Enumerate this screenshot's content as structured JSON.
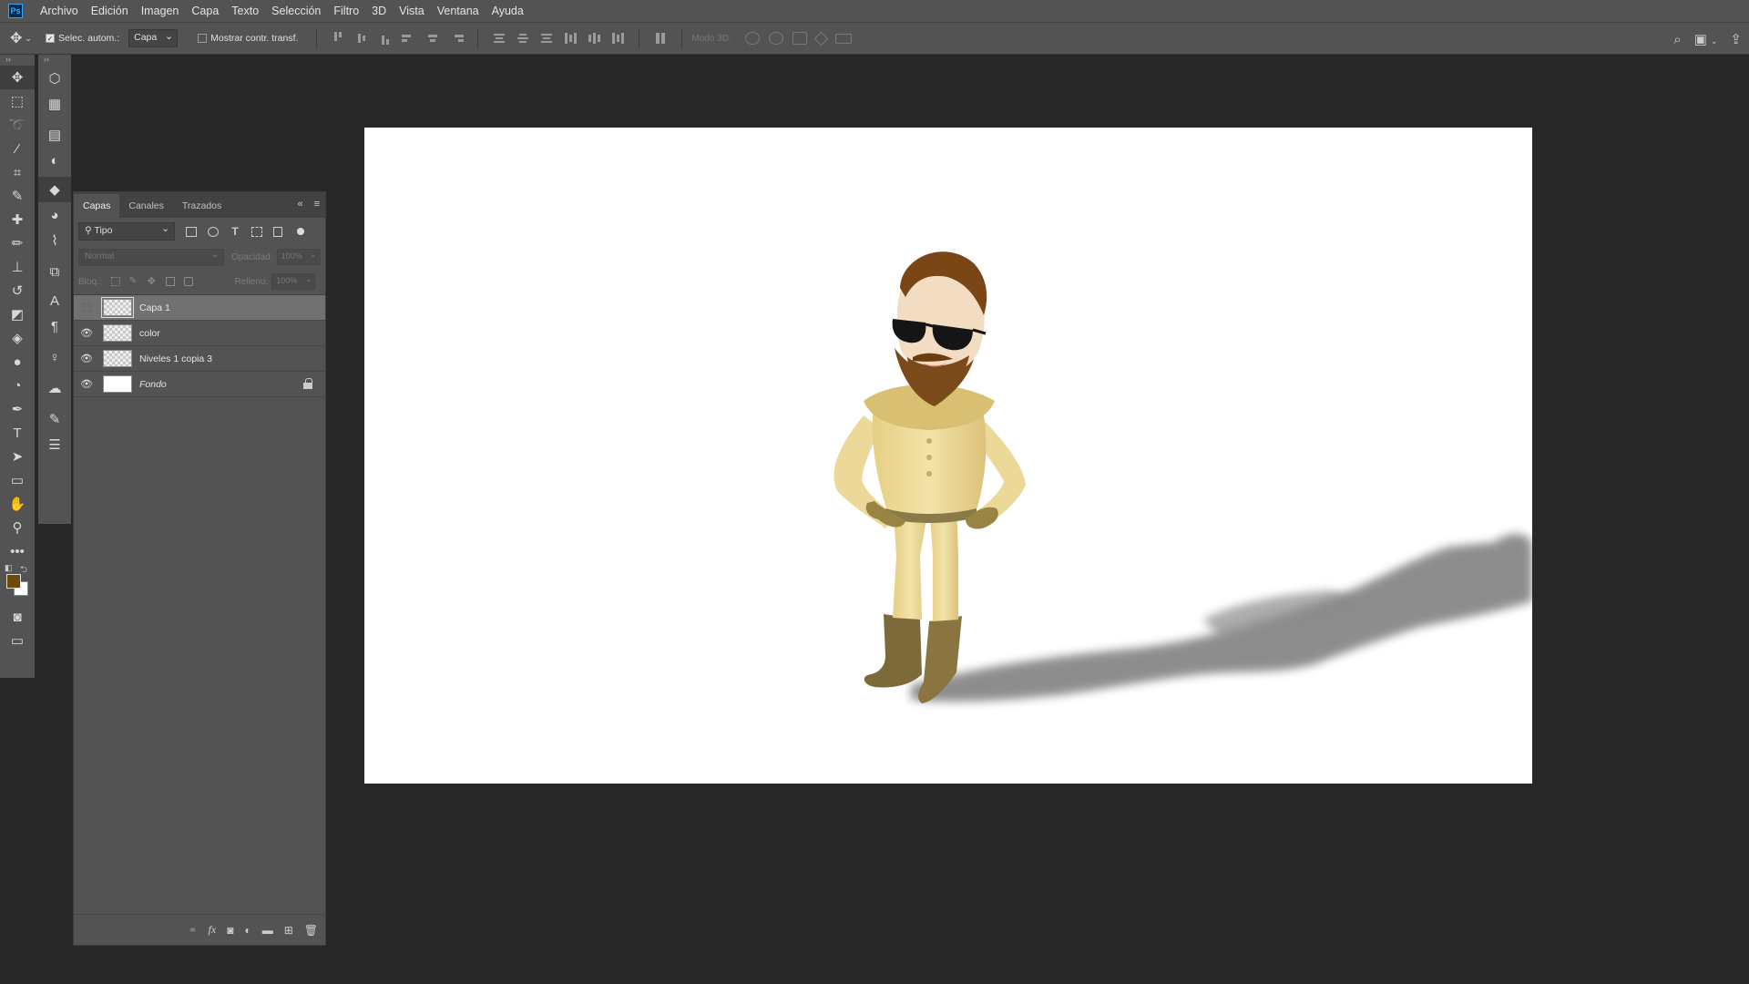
{
  "app": {
    "logo_text": "Ps"
  },
  "menu": [
    "Archivo",
    "Edición",
    "Imagen",
    "Capa",
    "Texto",
    "Selección",
    "Filtro",
    "3D",
    "Vista",
    "Ventana",
    "Ayuda"
  ],
  "options_bar": {
    "auto_select_label": "Selec. autom.:",
    "auto_select_checked": true,
    "auto_select_target": "Capa",
    "show_transform_label": "Mostrar contr. transf.",
    "show_transform_checked": false,
    "mode3d_label": "Modo 3D:"
  },
  "colors": {
    "foreground": "#6b4a0e",
    "background": "#ffffff"
  },
  "layers_panel": {
    "tabs": [
      "Capas",
      "Canales",
      "Trazados"
    ],
    "active_tab": "Capas",
    "filter_label": "Tipo",
    "blend_mode": "Normal",
    "opacity_label": "Opacidad:",
    "opacity_value": "100%",
    "lock_label": "Bloq.:",
    "fill_label": "Relleno:",
    "fill_value": "100%",
    "layers": [
      {
        "name": "Capa 1",
        "visible": false,
        "selected": true,
        "locked": false
      },
      {
        "name": "color",
        "visible": true,
        "selected": false,
        "locked": false
      },
      {
        "name": "Niveles 1 copia 3",
        "visible": true,
        "selected": false,
        "locked": false
      },
      {
        "name": "Fondo",
        "visible": true,
        "selected": false,
        "locked": true
      }
    ],
    "bottom_fx_label": "fx"
  }
}
